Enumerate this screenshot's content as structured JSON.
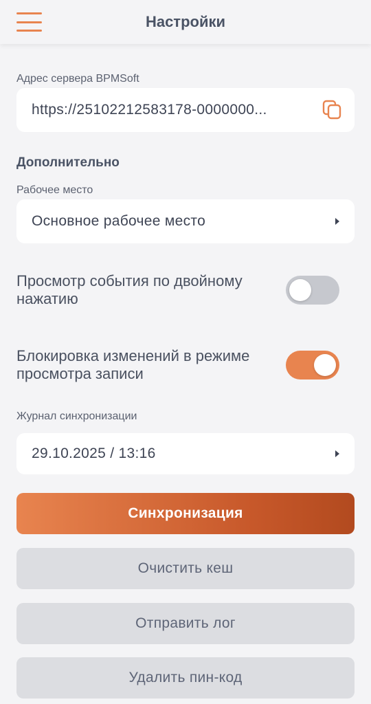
{
  "header": {
    "title": "Настройки"
  },
  "server": {
    "label": "Адрес сервера BPMSoft",
    "value": "https://25102212583178-0000000..."
  },
  "additional": {
    "title": "Дополнительно"
  },
  "workspace": {
    "label": "Рабочее место",
    "value": "Основное рабочее место"
  },
  "toggles": [
    {
      "label": "Просмотр события по двойному нажатию",
      "on": false
    },
    {
      "label": "Блокировка изменений в режиме просмотра записи",
      "on": true
    }
  ],
  "sync_log": {
    "label": "Журнал синхронизации",
    "value": "29.10.2025 / 13:16"
  },
  "buttons": {
    "sync": "Синхронизация",
    "clear_cache": "Очистить кеш",
    "send_log": "Отправить лог",
    "delete_pin": "Удалить пин-код"
  },
  "colors": {
    "accent": "#e8844f",
    "accent_dark": "#b24a1f",
    "background": "#f4f4f6",
    "secondary_button": "#dcdde1"
  },
  "icons": {
    "menu": "hamburger-menu-icon",
    "copy": "copy-icon",
    "chevron": "chevron-right-icon"
  }
}
